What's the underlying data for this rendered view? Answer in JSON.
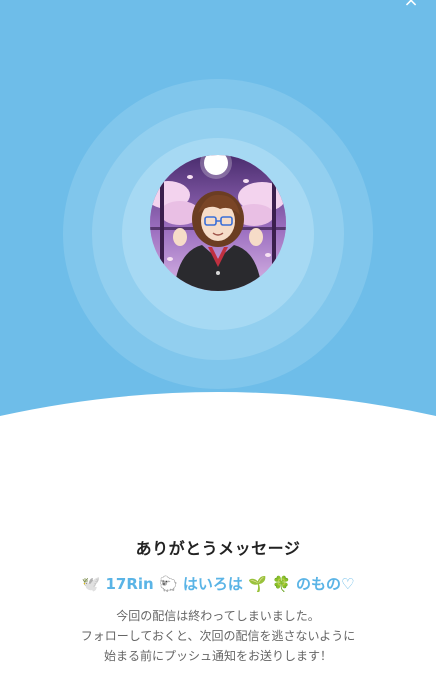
{
  "header": {
    "close_icon": "×"
  },
  "avatar": {
    "alt": "配信者アイコン"
  },
  "message": {
    "title": "ありがとうメッセージ",
    "streamer_name": {
      "prefix_emoji": "🕊️",
      "part1": "17Rin",
      "emoji2": "🐑",
      "part2": "はいろは",
      "emoji3": "🌱",
      "emoji4": "🍀",
      "part3": "のもの♡"
    },
    "description": [
      "今回の配信は終わってしまいました。",
      "フォローしておくと、次回の配信を逃さないように",
      "始まる前にプッシュ通知をお送りします！"
    ]
  },
  "colors": {
    "hero_background": "#6ebde9",
    "ring_outer": "#80c6ec",
    "ring_middle": "#92cfef",
    "ring_inner": "#a6d9f3",
    "accent_name": "#5ab4e6",
    "title_text": "#222222",
    "body_text": "#666666"
  }
}
